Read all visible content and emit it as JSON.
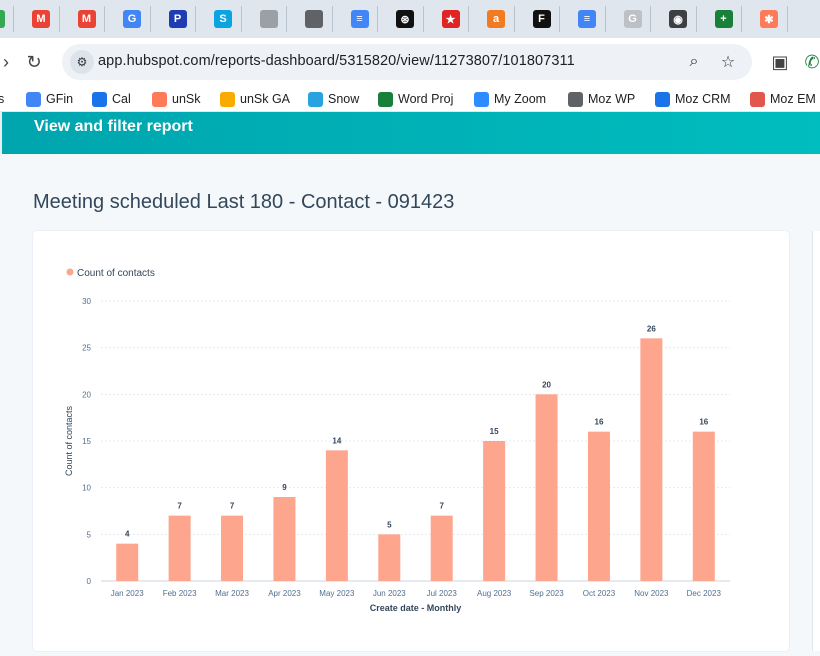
{
  "browser": {
    "tabs": [
      {
        "icon": "green-icon",
        "color": "#34a853",
        "glyph": ""
      },
      {
        "icon": "gmail-icon",
        "color": "#ea4335",
        "glyph": "M"
      },
      {
        "icon": "gmail-icon",
        "color": "#ea4335",
        "glyph": "M"
      },
      {
        "icon": "google-icon",
        "color": "#4285f4",
        "glyph": "G"
      },
      {
        "icon": "paypal-icon",
        "color": "#1f3cb3",
        "glyph": "P"
      },
      {
        "icon": "skype-icon",
        "color": "#0aa4e0",
        "glyph": "S"
      },
      {
        "icon": "doc-icon",
        "color": "#9aa0a6",
        "glyph": ""
      },
      {
        "icon": "globe-icon",
        "color": "#5f6368",
        "glyph": ""
      },
      {
        "icon": "docs-icon",
        "color": "#4285f4",
        "glyph": "≡"
      },
      {
        "icon": "openai-icon",
        "color": "#111111",
        "glyph": "⊛"
      },
      {
        "icon": "star-icon",
        "color": "#e02424",
        "glyph": "★"
      },
      {
        "icon": "alta-icon",
        "color": "#f27a20",
        "glyph": "a"
      },
      {
        "icon": "f-icon",
        "color": "#111111",
        "glyph": "F"
      },
      {
        "icon": "docs-icon",
        "color": "#4285f4",
        "glyph": "≡"
      },
      {
        "icon": "google-icon",
        "color": "#bdc1c6",
        "glyph": "G"
      },
      {
        "icon": "record-icon",
        "color": "#3c4043",
        "glyph": "◉"
      },
      {
        "icon": "sheets-icon",
        "color": "#188038",
        "glyph": "+"
      },
      {
        "icon": "hubspot-icon",
        "color": "#ff7a59",
        "glyph": "✱"
      }
    ],
    "url": "app.hubspot.com/reports-dashboard/5315820/view/11273807/101807311",
    "bookmarks": [
      {
        "label": "GFin",
        "icon": "gfin-icon",
        "color": "#4285f4"
      },
      {
        "label": "Cal",
        "icon": "calendar-icon",
        "color": "#1a73e8"
      },
      {
        "label": "unSk",
        "icon": "hubspot-icon",
        "color": "#ff7a59"
      },
      {
        "label": "unSk GA",
        "icon": "analytics-icon",
        "color": "#f9ab00"
      },
      {
        "label": "Snow",
        "icon": "shield-icon",
        "color": "#29a3e0"
      },
      {
        "label": "Word Proj",
        "icon": "sheets-icon",
        "color": "#188038"
      },
      {
        "label": "My Zoom",
        "icon": "zoom-icon",
        "color": "#2d8cff"
      },
      {
        "label": "Moz WP",
        "icon": "globe-icon",
        "color": "#5f6368"
      },
      {
        "label": "Moz CRM",
        "icon": "link-icon",
        "color": "#1a73e8"
      },
      {
        "label": "Moz EM",
        "icon": "mail-icon",
        "color": "#e2574c"
      }
    ]
  },
  "page": {
    "header_title": "View and filter report",
    "report_title": "Meeting scheduled Last 180 - Contact - 091423",
    "accent_color": "#00a4bd",
    "bar_color": "#fea58e"
  },
  "chart_data": {
    "type": "bar",
    "categories": [
      "Jan 2023",
      "Feb 2023",
      "Mar 2023",
      "Apr 2023",
      "May 2023",
      "Jun 2023",
      "Jul 2023",
      "Aug 2023",
      "Sep 2023",
      "Oct 2023",
      "Nov 2023",
      "Dec 2023"
    ],
    "series": [
      {
        "name": "Count of contacts",
        "values": [
          4,
          7,
          7,
          9,
          14,
          5,
          7,
          15,
          20,
          16,
          26,
          16
        ]
      }
    ],
    "xlabel": "Create date - Monthly",
    "ylabel": "Count of contacts",
    "ylim": [
      0,
      30
    ],
    "yticks": [
      0,
      5,
      10,
      15,
      20,
      25,
      30
    ],
    "grid": true,
    "legend_position": "top-left",
    "data_labels": true
  }
}
